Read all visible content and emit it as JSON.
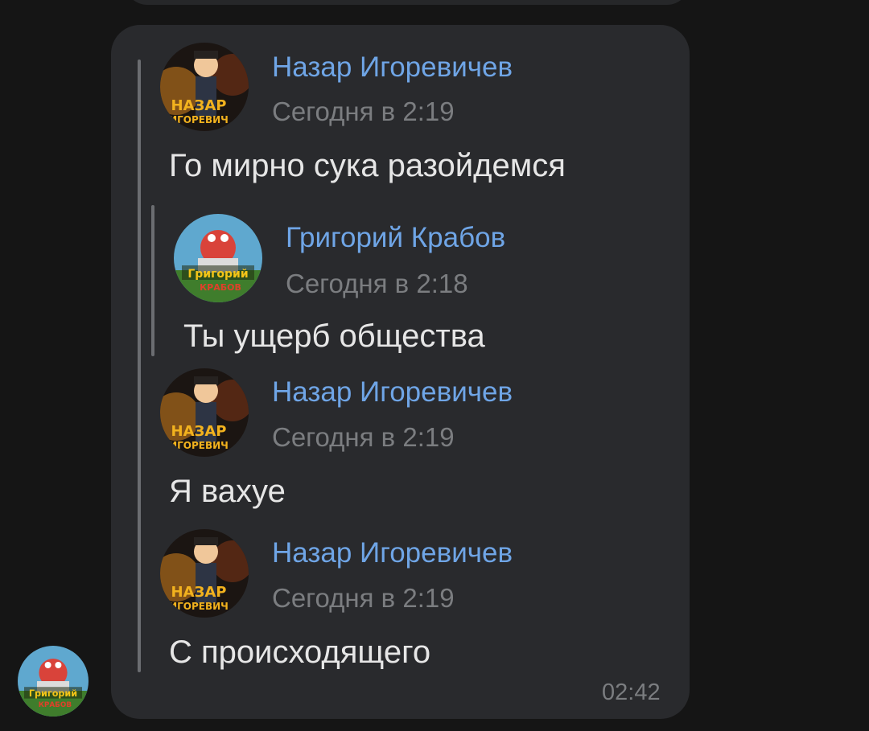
{
  "chat": {
    "bubble_time": "02:42",
    "forwarded": [
      {
        "author": "Назар Игоревичев",
        "time": "Сегодня в 2:19",
        "text": "Го мирно сука разойдемся",
        "avatar": "nazar-avatar"
      },
      {
        "author": "Григорий Крабов",
        "time": "Сегодня в 2:18",
        "text": "Ты ущерб общества",
        "avatar": "grigoriy-avatar"
      },
      {
        "author": "Назар Игоревичев",
        "time": "Сегодня в 2:19",
        "text": "Я вахуе",
        "avatar": "nazar-avatar"
      },
      {
        "author": "Назар Игоревичев",
        "time": "Сегодня в 2:19",
        "text": "С происходящего",
        "avatar": "nazar-avatar"
      }
    ]
  },
  "avatars": {
    "nazar_caption_1": "НАЗАР",
    "nazar_caption_2": "ИГОРЕВИЧ",
    "grigoriy_caption_1": "Григорий",
    "grigoriy_caption_2": "КРАБОВ"
  },
  "colors": {
    "author_link": "#6fa5e6",
    "bubble_bg": "#292a2d",
    "screen_bg": "#151515"
  }
}
